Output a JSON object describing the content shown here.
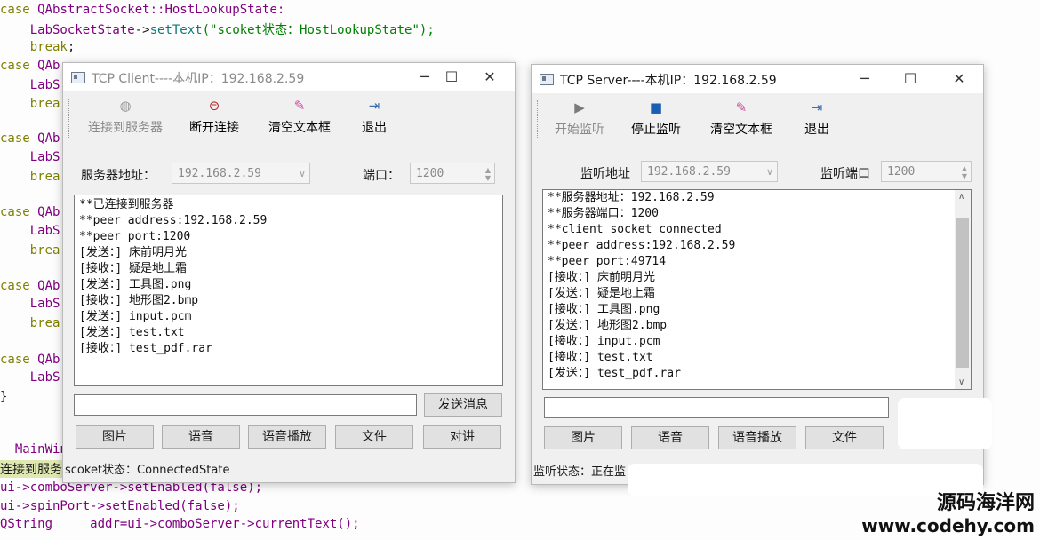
{
  "code_editor": {
    "lines_top": [
      {
        "kw": "case ",
        "rest": "QAbstractSocket::HostLookupState:"
      },
      {
        "indent": "    ",
        "obj": "LabSocketState",
        "arrow": "->",
        "fn": "setText",
        "str": "(\"scoket状态：HostLookupState\");"
      },
      {
        "indent": "    ",
        "kw": "break",
        "rest": ";"
      },
      {
        "kw": "case ",
        "rest": "QAb"
      },
      {
        "indent": "    ",
        "rest": "LabS"
      },
      {
        "indent": "    ",
        "kw": "brea"
      }
    ],
    "case_label": "case ",
    "case_frag": "QAb",
    "lab_frag": "LabS",
    "break_frag": "brea",
    "close_brace": "}",
    "main_frag": "MainWin",
    "connect_frag": "连接到服务器",
    "line_combo": "ui->comboServer->setEnabled(false);",
    "line_spin": "ui->spinPort->setEnabled(false);",
    "line_qstring_type": "QString",
    "line_qstring_rest": "     addr=ui->comboServer->currentText();"
  },
  "client": {
    "title": "TCP Client----本机IP：192.168.2.59",
    "toolbar": {
      "connect": "连接到服务器",
      "disconnect": "断开连接",
      "clear": "清空文本框",
      "exit": "退出"
    },
    "server_addr_label": "服务器地址：",
    "server_addr_value": "192.168.2.59",
    "port_label": "端口：",
    "port_value": "1200",
    "log": [
      "**已连接到服务器",
      "**peer address:192.168.2.59",
      "**peer port:1200",
      "[发送：] 床前明月光",
      "[接收：] 疑是地上霜",
      "[发送：] 工具图.png",
      "[接收：] 地形图2.bmp",
      "[发送：] input.pcm",
      "[发送：] test.txt",
      "[接收：] test_pdf.rar"
    ],
    "send_button": "发送消息",
    "buttons": [
      "图片",
      "语音",
      "语音播放",
      "文件",
      "对讲"
    ],
    "status": "scoket状态：ConnectedState"
  },
  "server": {
    "title": "TCP Server----本机IP：192.168.2.59",
    "toolbar": {
      "start": "开始监听",
      "stop": "停止监听",
      "clear": "清空文本框",
      "exit": "退出"
    },
    "listen_addr_label": "监听地址",
    "listen_addr_value": "192.168.2.59",
    "listen_port_label": "监听端口",
    "listen_port_value": "1200",
    "log": [
      "**服务器地址：192.168.2.59",
      "**服务器端口：1200",
      "**client socket connected",
      "**peer address:192.168.2.59",
      "**peer port:49714",
      "[接收：] 床前明月光",
      "[发送：] 疑是地上霜",
      "[接收：] 工具图.png",
      "[发送：] 地形图2.bmp",
      "[接收：] input.pcm",
      "[接收：] test.txt",
      "[发送：] test_pdf.rar"
    ],
    "buttons": [
      "图片",
      "语音",
      "语音播放",
      "文件"
    ],
    "status": "监听状态：正在监"
  },
  "watermark": {
    "line1": "源码海洋网",
    "line2": "www.codehy.com"
  },
  "colors": {
    "keyword": "#808000",
    "string": "#008000",
    "function": "#0a7a7a",
    "connect_icon": "#9a9a9a",
    "stop_icon": "#1a5fb4",
    "window_bg": "#f0f0f0"
  }
}
